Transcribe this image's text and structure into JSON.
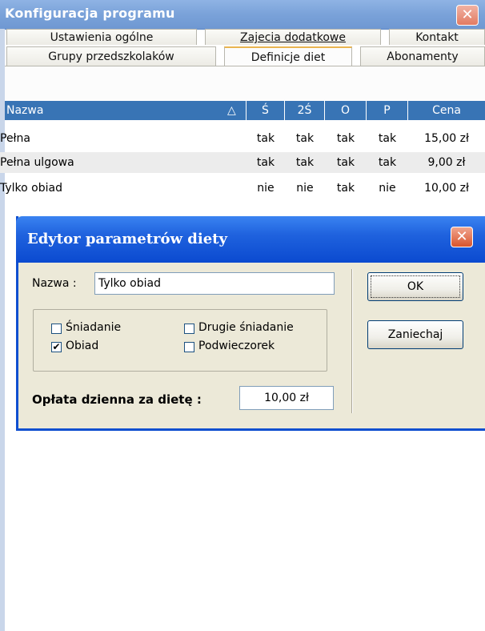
{
  "window": {
    "title": "Konfiguracja programu",
    "close_glyph": "✕"
  },
  "tabs_row1": [
    {
      "label": "Ustawienia ogólne"
    },
    {
      "label": "Zajecia dodatkowe"
    },
    {
      "label": "Kontakt"
    }
  ],
  "tabs_row2": [
    {
      "label": "Grupy przedszkolaków"
    },
    {
      "label": "Definicje diet"
    },
    {
      "label": "Abonamenty"
    }
  ],
  "grid": {
    "columns": [
      "Nazwa",
      "Ś",
      "2Ś",
      "O",
      "P",
      "Cena"
    ],
    "sort_indicator": "△",
    "rows": [
      [
        "Pełna",
        "tak",
        "tak",
        "tak",
        "tak",
        "15,00 zł"
      ],
      [
        "Pełna ulgowa",
        "tak",
        "tak",
        "tak",
        "tak",
        "9,00 zł"
      ],
      [
        "Tylko obiad",
        "nie",
        "nie",
        "tak",
        "nie",
        "10,00 zł"
      ]
    ]
  },
  "dialog": {
    "title": "Edytor parametrów diety",
    "name_label": "Nazwa :",
    "name_value": "Tylko obiad",
    "checkboxes": [
      {
        "label": "Śniadanie",
        "checked": false
      },
      {
        "label": "Drugie śniadanie",
        "checked": false
      },
      {
        "label": "Obiad",
        "checked": true
      },
      {
        "label": "Podwieczorek",
        "checked": false
      }
    ],
    "fee_label": "Opłata dzienna za dietę :",
    "fee_value": "10,00 zł",
    "ok_label": "OK",
    "cancel_label": "Zaniechaj",
    "check_glyph": "✔"
  },
  "colors": {
    "title_bar": "#7aa2d9",
    "grid_header": "#3874b5",
    "dialog_title": "#0b4ad0",
    "dialog_bg": "#ece9d8"
  }
}
